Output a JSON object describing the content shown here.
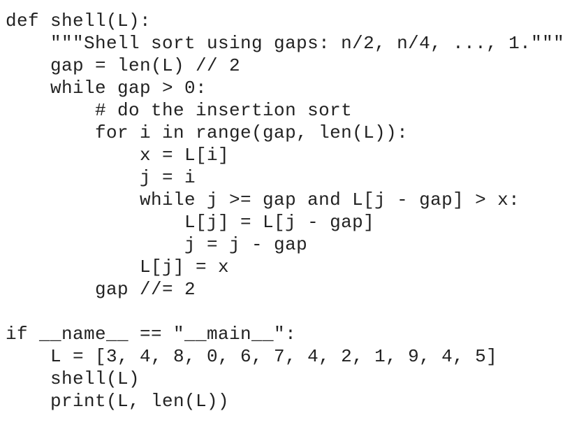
{
  "code": {
    "lines": [
      "def shell(L):",
      "    \"\"\"Shell sort using gaps: n/2, n/4, ..., 1.\"\"\"",
      "    gap = len(L) // 2",
      "    while gap > 0:",
      "        # do the insertion sort",
      "        for i in range(gap, len(L)):",
      "            x = L[i]",
      "            j = i",
      "            while j >= gap and L[j - gap] > x:",
      "                L[j] = L[j - gap]",
      "                j = j - gap",
      "            L[j] = x",
      "        gap //= 2",
      "",
      "if __name__ == \"__main__\":",
      "    L = [3, 4, 8, 0, 6, 7, 4, 2, 1, 9, 4, 5]",
      "    shell(L)",
      "    print(L, len(L))"
    ]
  }
}
